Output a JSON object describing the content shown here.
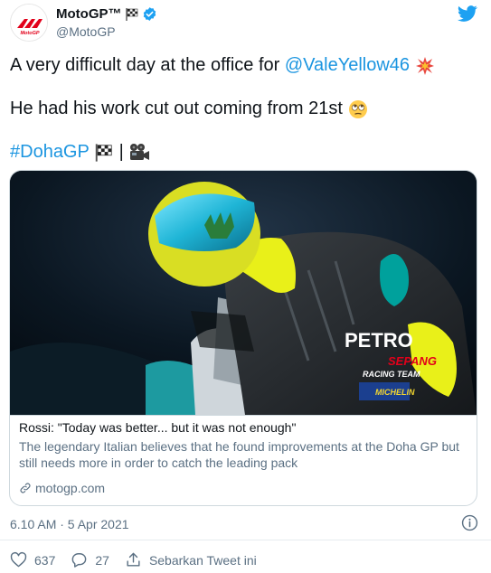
{
  "account": {
    "display_name": "MotoGP™",
    "handle": "@MotoGP",
    "verified": true,
    "avatar_icon": "motogp-logo",
    "header_emoji": "chequered-flag-emoji"
  },
  "tweet": {
    "line1_text": "A very difficult day at the office for ",
    "line1_mention": "@ValeYellow46",
    "line1_emoji": "collision-emoji",
    "line2_text": "He had his work cut out coming from 21st",
    "line2_emoji": "face-with-rolling-eyes-emoji",
    "line3_hashtag": "#DohaGP",
    "line3_separator": "|",
    "line3_emojis": [
      "chequered-flag-emoji",
      "movie-camera-emoji"
    ]
  },
  "card": {
    "title": "Rossi: \"Today was better... but it was not enough\"",
    "description": "The legendary Italian believes that he found improvements at the Doha GP but still needs more in order to catch the leading pack",
    "domain": "motogp.com",
    "image_text": {
      "sponsor": "PETRO",
      "sepang": "SEPANG",
      "racing": "RACING TEAM",
      "michelin": "MICHELIN"
    }
  },
  "meta": {
    "timestamp": "6.10 AM · 5 Apr 2021"
  },
  "actions": {
    "like_count": "637",
    "reply_count": "27",
    "share_label": "Sebarkan Tweet ini"
  },
  "colors": {
    "accent": "#1b95e0",
    "twitter_blue": "#1da1f2",
    "muted": "#5b7083",
    "border": "#cfd9de"
  }
}
